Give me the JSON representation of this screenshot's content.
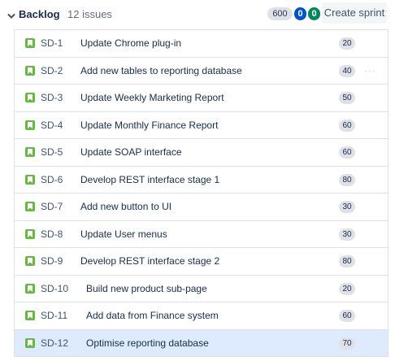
{
  "backlog": {
    "title": "Backlog",
    "issue_count": "12 issues",
    "totals": {
      "grey": "600",
      "blue": "0",
      "green": "0"
    },
    "create_sprint_label": "Create sprint"
  },
  "issues": [
    {
      "key": "SD-1",
      "summary": "Update Chrome plug-in",
      "points": "20",
      "selected": false
    },
    {
      "key": "SD-2",
      "summary": "Add new tables to reporting database",
      "points": "40",
      "selected": false,
      "more": "···"
    },
    {
      "key": "SD-3",
      "summary": "Update Weekly Marketing Report",
      "points": "50",
      "selected": false
    },
    {
      "key": "SD-4",
      "summary": "Update Monthly Finance Report",
      "points": "60",
      "selected": false
    },
    {
      "key": "SD-5",
      "summary": "Update SOAP interface",
      "points": "60",
      "selected": false
    },
    {
      "key": "SD-6",
      "summary": "Develop REST interface stage 1",
      "points": "80",
      "selected": false
    },
    {
      "key": "SD-7",
      "summary": "Add new button to UI",
      "points": "30",
      "selected": false
    },
    {
      "key": "SD-8",
      "summary": "Update User menus",
      "points": "30",
      "selected": false
    },
    {
      "key": "SD-9",
      "summary": "Develop REST interface stage 2",
      "points": "80",
      "selected": false
    },
    {
      "key": "SD-10",
      "summary": "Build new product sub-page",
      "points": "20",
      "selected": false
    },
    {
      "key": "SD-11",
      "summary": "Add data from Finance system",
      "points": "60",
      "selected": false
    },
    {
      "key": "SD-12",
      "summary": "Optimise reporting database",
      "points": "70",
      "selected": true
    }
  ],
  "colors": {
    "story_icon": "#63ba3c",
    "selected_row": "#deebff",
    "status_blue": "#0052cc",
    "status_green": "#00875a"
  },
  "icons": {
    "collapse": "chevron-down-icon",
    "issue_type": "story-icon"
  }
}
